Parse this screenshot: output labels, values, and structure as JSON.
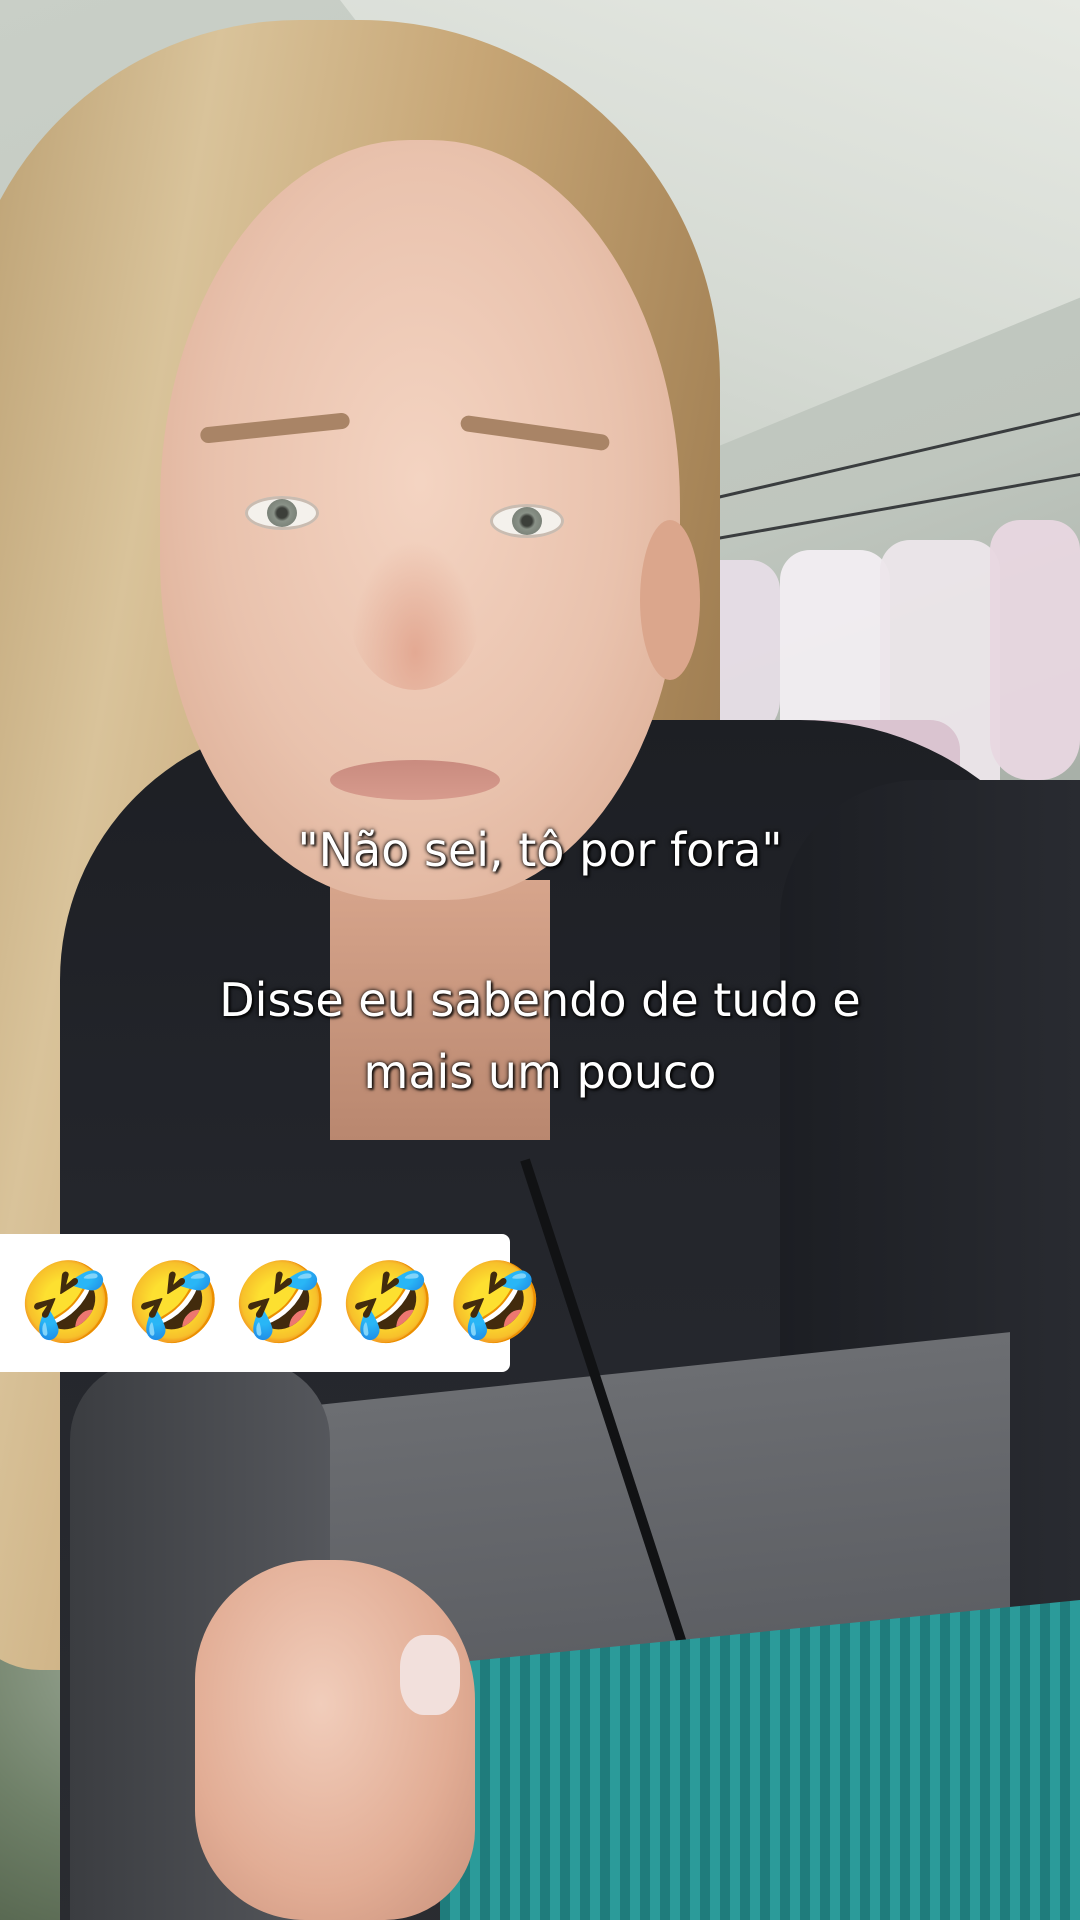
{
  "overlay": {
    "caption_quote": "\"Não sei, tô por fora\"",
    "caption_body": "Disse eu sabendo de tudo e\nmais um pouco",
    "emoji_row": [
      "🤣",
      "🤣",
      "🤣",
      "🤣",
      "🤣"
    ]
  },
  "colors": {
    "caption_text": "#ffffff",
    "emoji_box_background": "#ffffff"
  },
  "icons": {
    "emoji_semantic": "rolling-on-the-floor-laughing"
  }
}
